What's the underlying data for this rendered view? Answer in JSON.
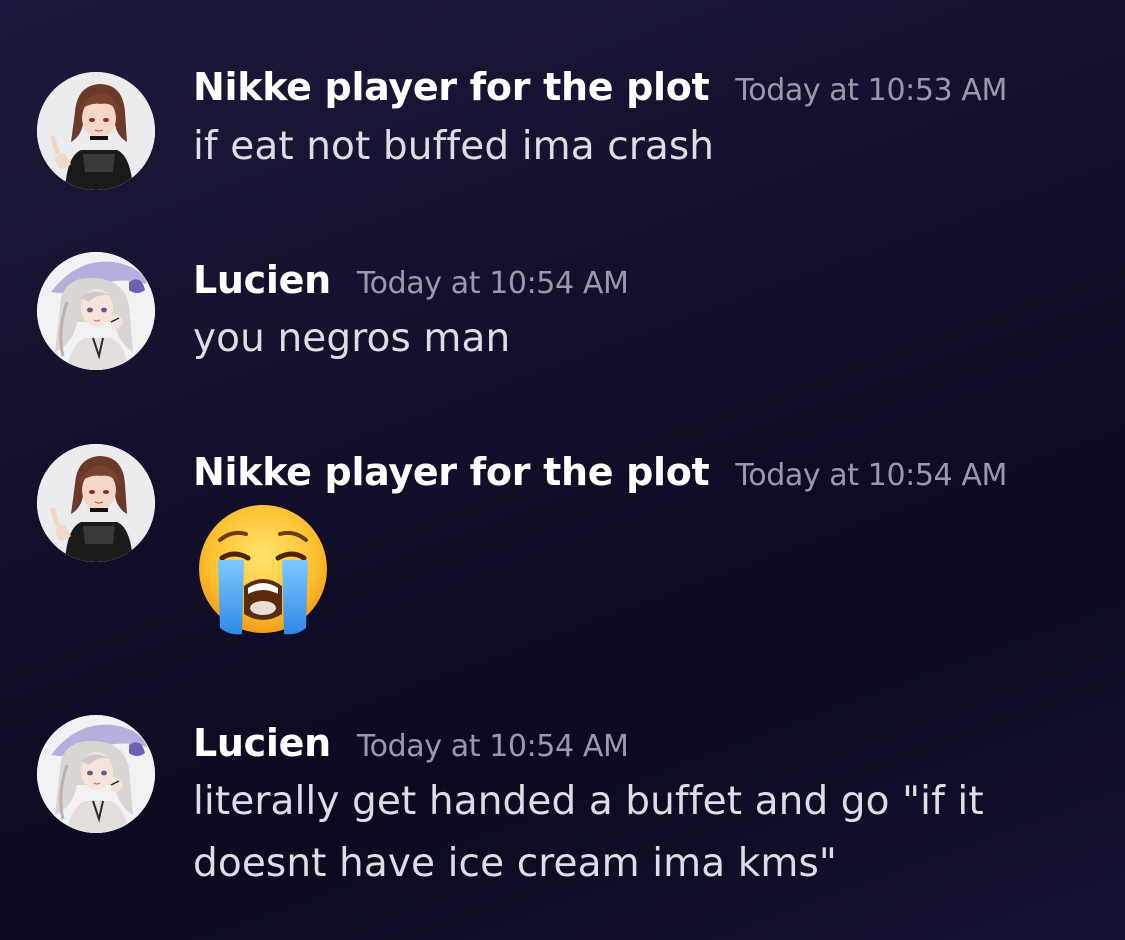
{
  "messages": [
    {
      "username": "Nikke player for the plot",
      "timestamp": "Today at 10:53 AM",
      "text": "if eat not buffed ima crash"
    },
    {
      "username": "Lucien",
      "timestamp": "Today at 10:54 AM",
      "text": "you negros man"
    },
    {
      "username": "Nikke player for the plot",
      "timestamp": "Today at 10:54 AM",
      "emoji": "loudly-crying-face-emoji"
    },
    {
      "username": "Lucien",
      "timestamp": "Today at 10:54 AM",
      "text_line1": "literally get handed a buffet and go \"if it",
      "text_line2": "doesnt have ice cream ima kms\""
    }
  ],
  "colors": {
    "username": "#ffffff",
    "timestamp": "#9a99ab",
    "message_text": "#dddde4",
    "background": "#120f2b"
  }
}
